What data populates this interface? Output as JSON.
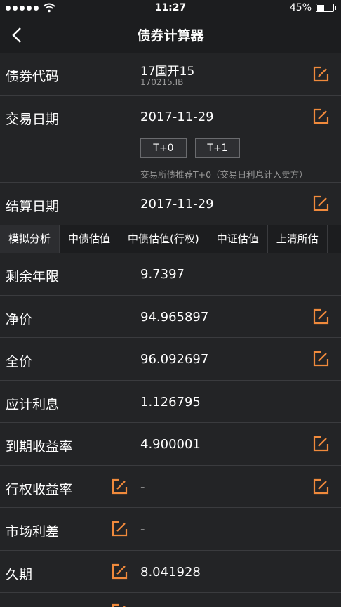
{
  "status": {
    "time": "11:27",
    "battery": "45%",
    "battery_level": 0.45
  },
  "nav": {
    "title": "债券计算器"
  },
  "bond_code": {
    "label": "债券代码",
    "name": "17国开15",
    "code": "170215.IB"
  },
  "trade_date": {
    "label": "交易日期",
    "value": "2017-11-29",
    "t0": "T+0",
    "t1": "T+1",
    "note": "交易所债推荐T+0（交易日利息计入卖方）"
  },
  "settle_date": {
    "label": "结算日期",
    "value": "2017-11-29"
  },
  "tabs": [
    "模拟分析",
    "中债估值",
    "中债估值(行权)",
    "中证估值",
    "上清所估"
  ],
  "metrics": {
    "remaining": {
      "label": "剩余年限",
      "value": "9.7397"
    },
    "clean": {
      "label": "净价",
      "value": "94.965897"
    },
    "dirty": {
      "label": "全价",
      "value": "96.092697"
    },
    "accrued": {
      "label": "应计利息",
      "value": "1.126795"
    },
    "ytm": {
      "label": "到期收益率",
      "value": "4.900001"
    },
    "ytc": {
      "label": "行权收益率",
      "value": "-"
    },
    "spread": {
      "label": "市场利差",
      "value": "-"
    },
    "duration": {
      "label": "久期",
      "value": "8.041928"
    }
  },
  "colors": {
    "accent": "#f08a3c",
    "background": "#232426",
    "bar": "#1c1d1f"
  }
}
